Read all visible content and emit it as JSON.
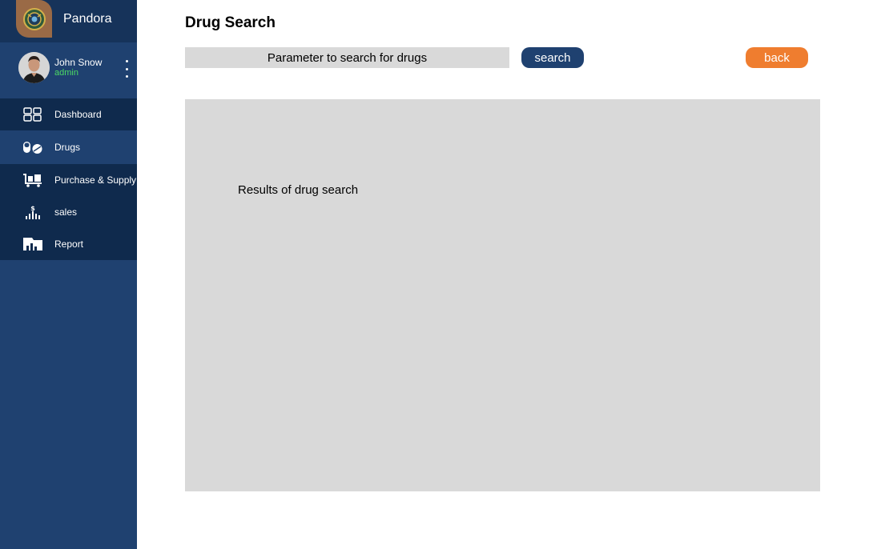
{
  "brand": {
    "name": "Pandora"
  },
  "user": {
    "name": "John Snow",
    "role": "admin"
  },
  "nav": [
    {
      "label": "Dashboard",
      "icon": "dashboard-icon"
    },
    {
      "label": "Drugs",
      "icon": "pills-icon"
    },
    {
      "label": "Purchase & Supply",
      "icon": "cart-icon"
    },
    {
      "label": "sales",
      "icon": "sales-icon"
    },
    {
      "label": "Report",
      "icon": "report-icon"
    }
  ],
  "page": {
    "title": "Drug Search"
  },
  "search": {
    "placeholder": "Parameter to search for drugs",
    "button": "search"
  },
  "back_button": "back",
  "results": {
    "text": "Results of drug search"
  },
  "colors": {
    "sidebar": "#1f4170",
    "sidebar_dark": "#0f2a4d",
    "brand_bg": "#16335a",
    "primary_button": "#1f4170",
    "back_button": "#ef7d2f",
    "panel": "#d9d9d9",
    "role": "#4cd964"
  }
}
